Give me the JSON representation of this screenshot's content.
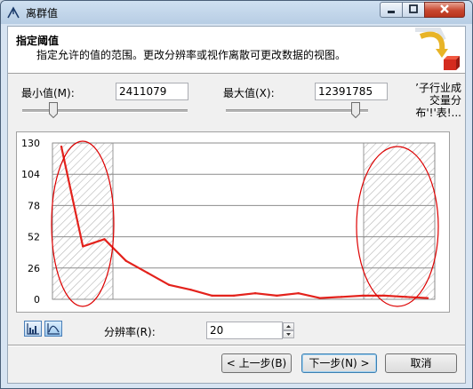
{
  "window": {
    "title": "离群值"
  },
  "header": {
    "title": "指定阈值",
    "subtitle": "指定允许的值的范围。更改分辨率或视作离散可更改数据的视图。"
  },
  "min": {
    "label": "最小值(M):",
    "value": "2411079"
  },
  "max": {
    "label": "最大值(X):",
    "value": "12391785"
  },
  "status": {
    "line1": "’子行业成",
    "line2": "交量分",
    "line3": "布'!'表!..."
  },
  "resolution": {
    "label": "分辨率(R):",
    "value": "20"
  },
  "buttons": {
    "back": "< 上一步(B)",
    "next": "下一步(N) >",
    "cancel": "取消"
  },
  "icons": {
    "title": "wizard-arrow-icon",
    "header": "cube-arrow-icon",
    "bar_view": "bar-chart-view-icon",
    "line_view": "line-chart-view-icon"
  },
  "colors": {
    "series": "#e3221c",
    "annotation": "#dd0000"
  },
  "chart_data": {
    "type": "line",
    "title": "",
    "xlabel": "",
    "ylabel": "",
    "ylim": [
      0,
      130
    ],
    "yticks": [
      "0",
      "26",
      "52",
      "78",
      "104",
      "130"
    ],
    "grid": true,
    "excluded_ranges": [
      "left",
      "right"
    ],
    "series": [
      {
        "values": [
          127,
          44,
          50,
          32,
          22,
          12,
          8,
          3,
          3,
          5,
          3,
          5,
          1,
          2,
          3,
          3,
          2,
          1
        ]
      }
    ]
  }
}
